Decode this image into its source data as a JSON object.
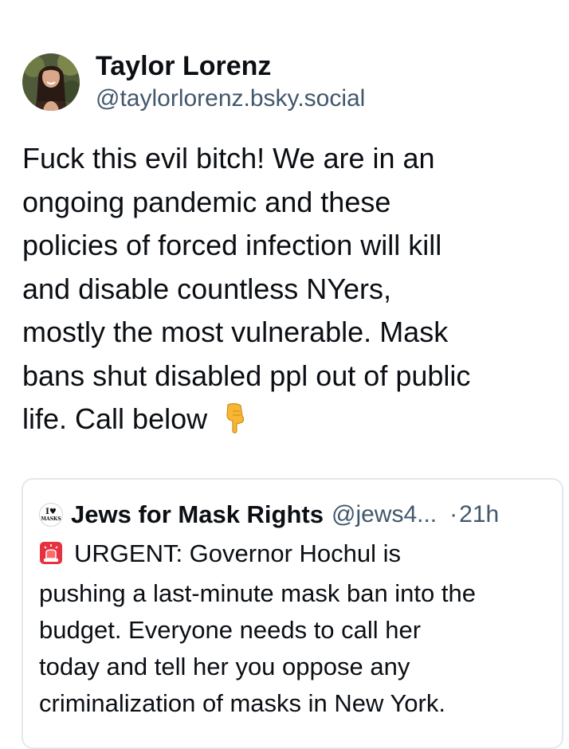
{
  "post": {
    "author": {
      "display_name": "Taylor Lorenz",
      "handle": "@taylorlorenz.bsky.social",
      "avatar_icon": "profile-photo"
    },
    "text": "Fuck this evil bitch! We are in an\nongoing pandemic and these\npolicies of forced infection will kill\nand disable countless NYers,\nmostly the most vulnerable. Mask\nbans shut disabled ppl out of public\nlife. Call below",
    "text_emoji": "backhand-index-pointing-down-icon"
  },
  "quote": {
    "avatar_text_top": "I♥",
    "avatar_text_bottom": "MASKS",
    "display_name": "Jews for Mask Rights",
    "handle": "@jews4...",
    "separator": "·",
    "time": "21h",
    "lead_emoji": "police-siren-icon",
    "text": "URGENT: Governor Hochul is\npushing a last-minute mask ban into the\nbudget. Everyone needs to call her\ntoday and tell her you oppose any\ncriminalization of masks in New York."
  },
  "colors": {
    "text_primary": "#0b0f14",
    "text_secondary": "#42576c",
    "card_border": "#e3e8ed",
    "background": "#ffffff"
  }
}
